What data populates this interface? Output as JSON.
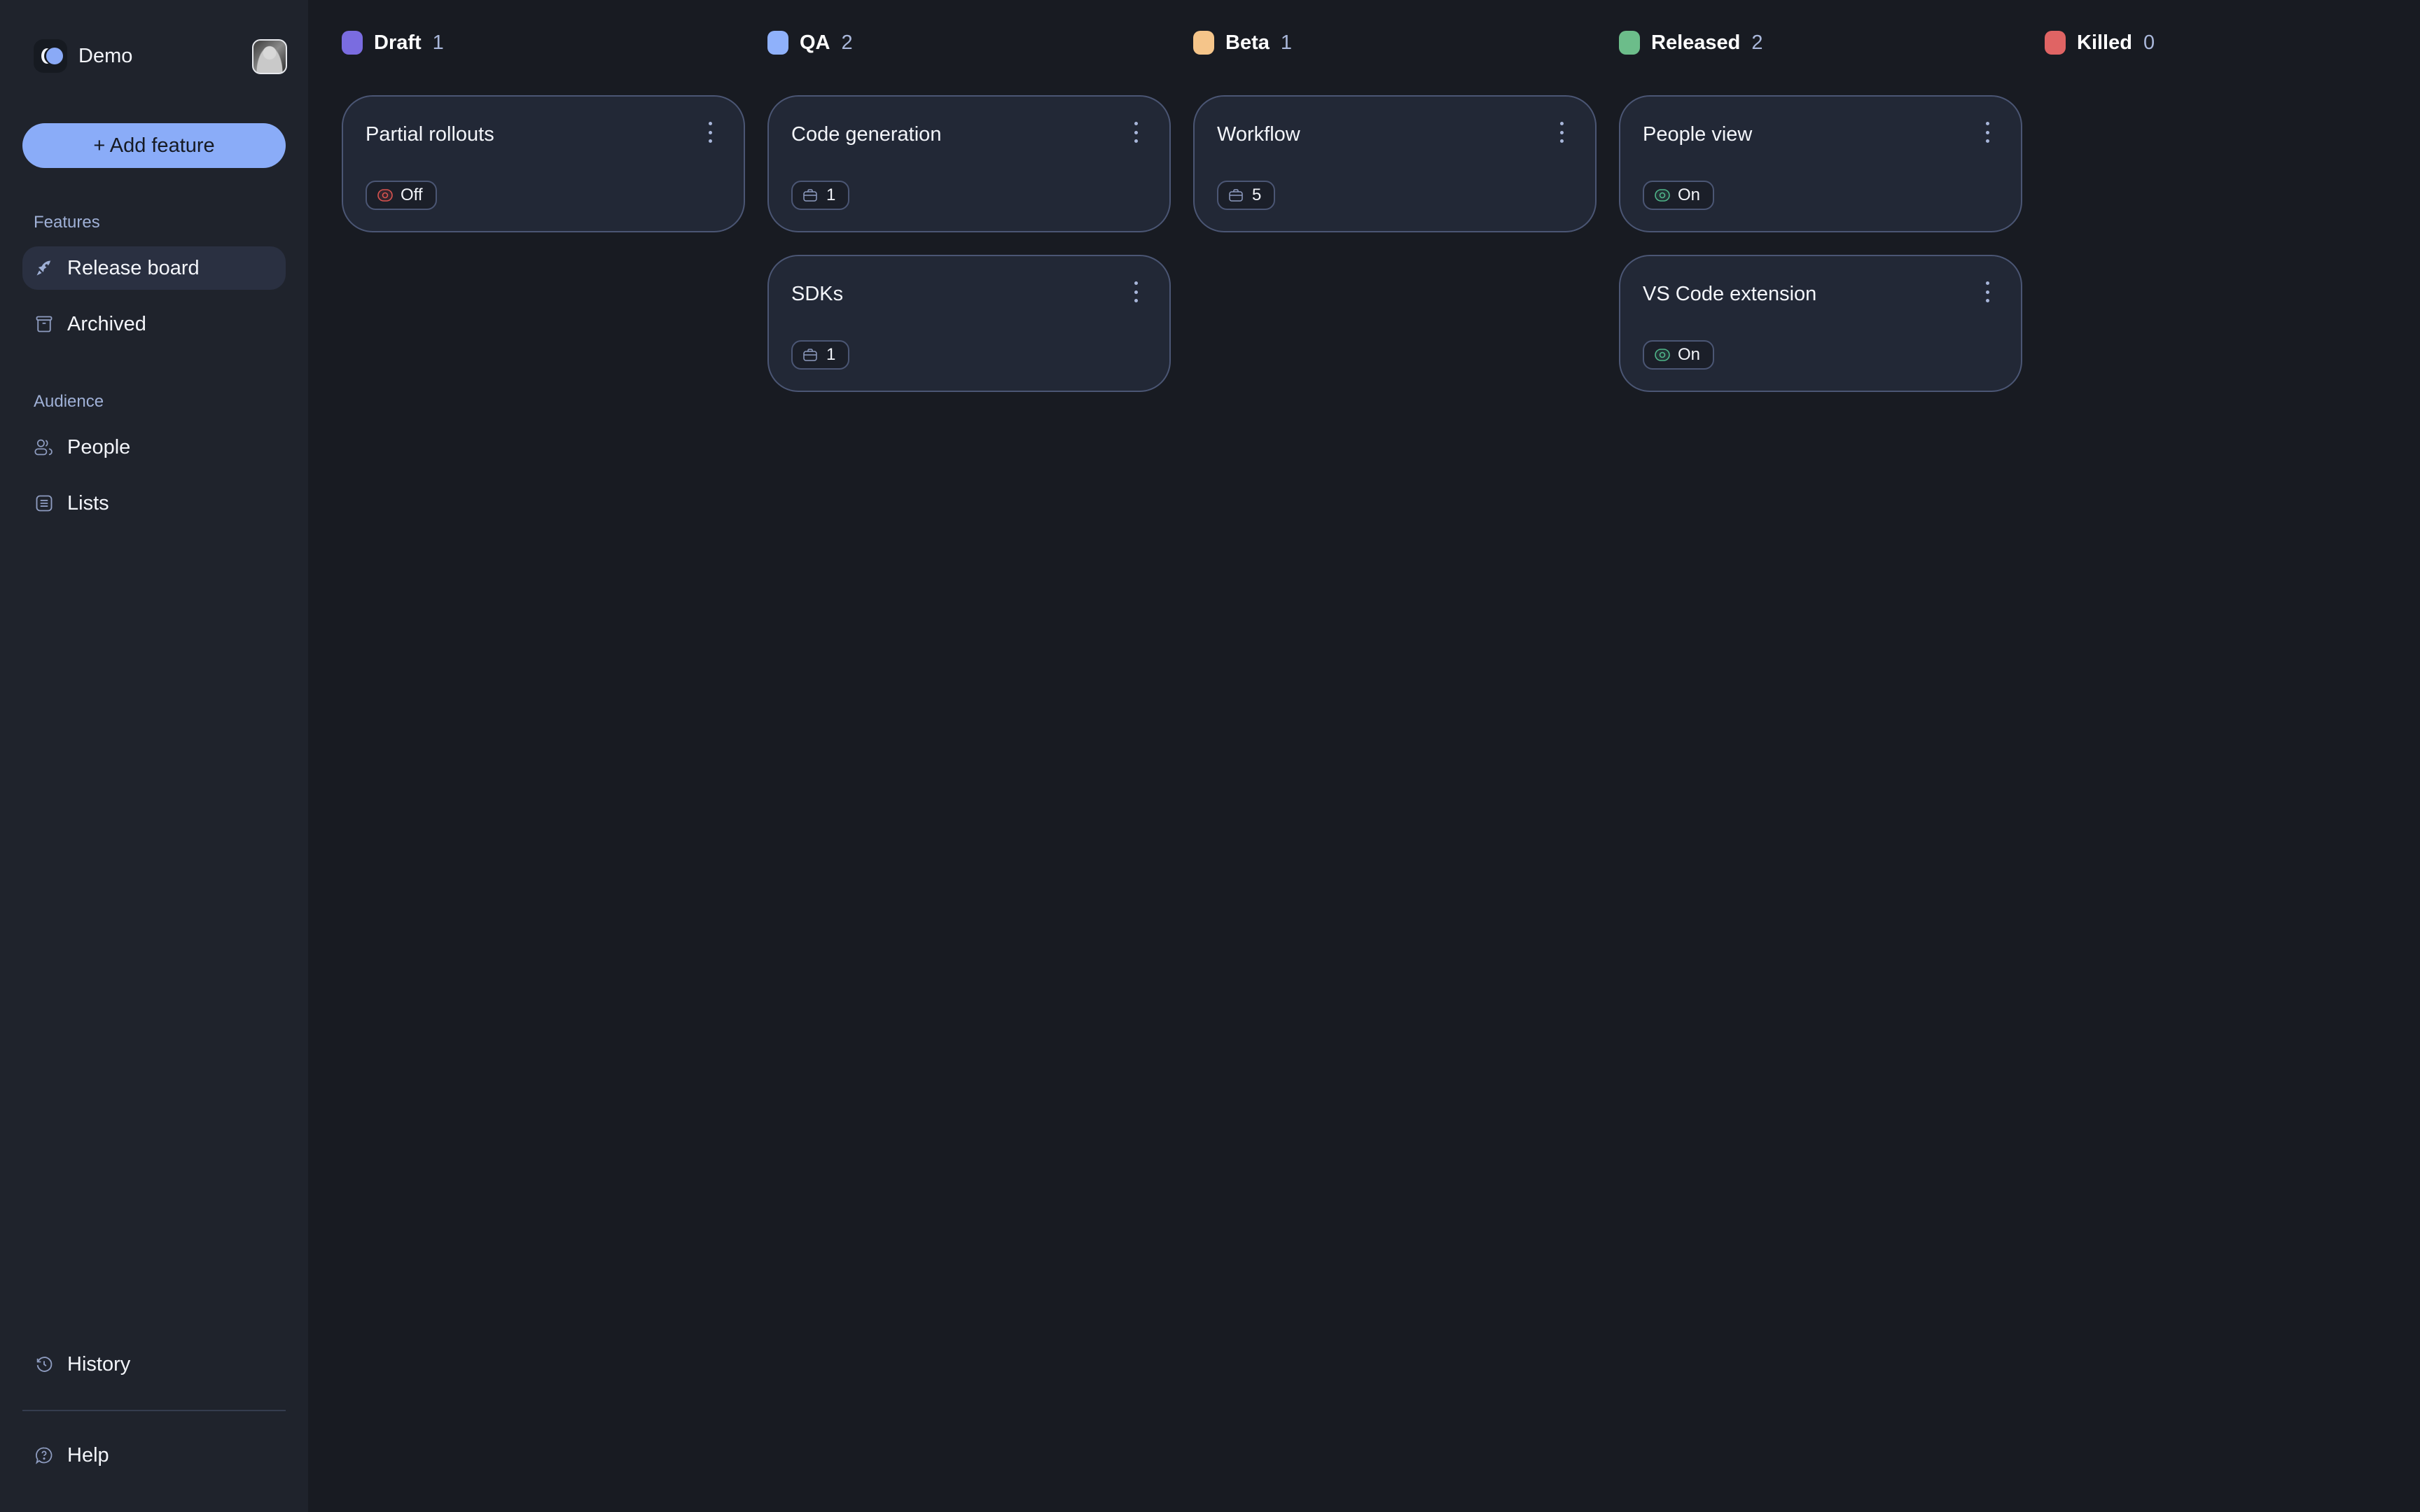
{
  "workspace": {
    "name": "Demo"
  },
  "sidebar": {
    "add_feature_label": "+ Add feature",
    "sections": [
      {
        "label": "Features"
      },
      {
        "label": "Audience"
      }
    ],
    "items": [
      {
        "label": "Release board",
        "icon": "rocket-icon",
        "active": true
      },
      {
        "label": "Archived",
        "icon": "archive-icon"
      },
      {
        "label": "People",
        "icon": "people-icon"
      },
      {
        "label": "Lists",
        "icon": "list-icon"
      }
    ],
    "footer_items": [
      {
        "label": "History",
        "icon": "history-icon"
      },
      {
        "label": "Help",
        "icon": "help-icon"
      }
    ]
  },
  "board": {
    "columns": [
      {
        "name": "Draft",
        "count": "1",
        "color": "#7a6ce0",
        "cards": [
          {
            "title": "Partial rollouts",
            "badge": {
              "type": "toggle",
              "state": "off",
              "label": "Off"
            }
          }
        ]
      },
      {
        "name": "QA",
        "count": "2",
        "color": "#8fb1fb",
        "cards": [
          {
            "title": "Code generation",
            "badge": {
              "type": "briefcase",
              "label": "1"
            }
          },
          {
            "title": "SDKs",
            "badge": {
              "type": "briefcase",
              "label": "1"
            }
          }
        ]
      },
      {
        "name": "Beta",
        "count": "1",
        "color": "#f5c58a",
        "cards": [
          {
            "title": "Workflow",
            "badge": {
              "type": "briefcase",
              "label": "5"
            }
          }
        ]
      },
      {
        "name": "Released",
        "count": "2",
        "color": "#6cbd8a",
        "cards": [
          {
            "title": "People view",
            "badge": {
              "type": "toggle",
              "state": "on",
              "label": "On"
            }
          },
          {
            "title": "VS Code extension",
            "badge": {
              "type": "toggle",
              "state": "on",
              "label": "On"
            }
          }
        ]
      },
      {
        "name": "Killed",
        "count": "0",
        "color": "#e06464",
        "cards": []
      }
    ]
  },
  "colors": {
    "toggle_on": "#4fb68a",
    "toggle_off": "#d9534f",
    "accent": "#8aacf8"
  }
}
